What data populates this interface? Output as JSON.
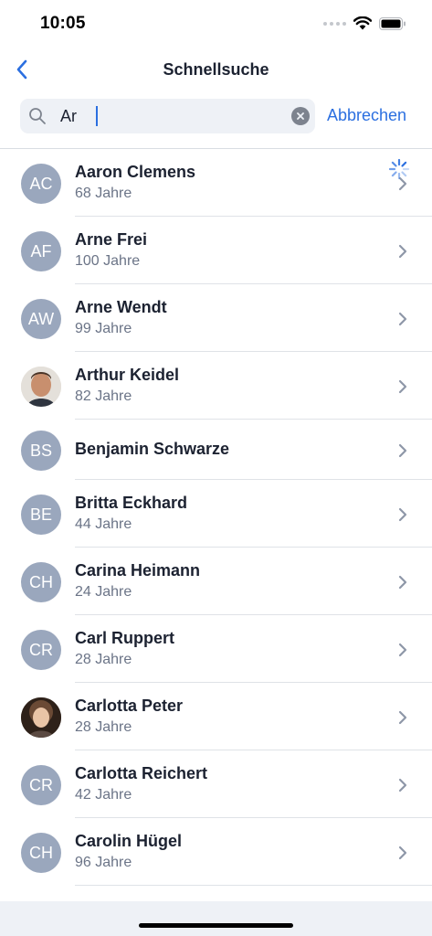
{
  "status_bar": {
    "time": "10:05"
  },
  "nav": {
    "title": "Schnellsuche"
  },
  "search": {
    "value": "Ar",
    "cancel_label": "Abbrechen"
  },
  "contacts": [
    {
      "initials": "AC",
      "name": "Aaron Clemens",
      "age": "68 Jahre",
      "photo": false,
      "loading": true
    },
    {
      "initials": "AF",
      "name": "Arne Frei",
      "age": "100 Jahre",
      "photo": false
    },
    {
      "initials": "AW",
      "name": "Arne Wendt",
      "age": "99 Jahre",
      "photo": false
    },
    {
      "initials": "",
      "name": "Arthur Keidel",
      "age": "82 Jahre",
      "photo": true,
      "photo_kind": "man"
    },
    {
      "initials": "BS",
      "name": "Benjamin Schwarze",
      "age": "",
      "photo": false
    },
    {
      "initials": "BE",
      "name": "Britta Eckhard",
      "age": "44 Jahre",
      "photo": false
    },
    {
      "initials": "CH",
      "name": "Carina Heimann",
      "age": "24 Jahre",
      "photo": false
    },
    {
      "initials": "CR",
      "name": "Carl Ruppert",
      "age": "28 Jahre",
      "photo": false
    },
    {
      "initials": "",
      "name": "Carlotta Peter",
      "age": "28 Jahre",
      "photo": true,
      "photo_kind": "woman"
    },
    {
      "initials": "CR",
      "name": "Carlotta Reichert",
      "age": "42 Jahre",
      "photo": false
    },
    {
      "initials": "CH",
      "name": "Carolin Hügel",
      "age": "96 Jahre",
      "photo": false
    }
  ],
  "colors": {
    "accent": "#2b6fe0",
    "avatar_bg": "#9aa7bd",
    "search_bg": "#eef1f6",
    "chevron": "#8e97a8"
  }
}
